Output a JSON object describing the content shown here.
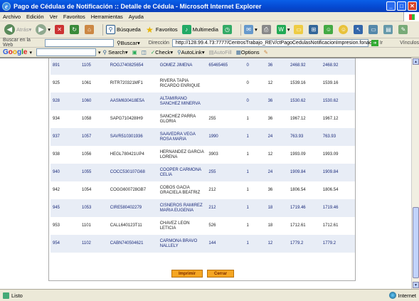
{
  "window": {
    "title": "Pago de Cédulas de Notificación :: Detalle de Cédula - Microsoft Internet Explorer"
  },
  "menu": [
    "Archivo",
    "Edición",
    "Ver",
    "Favoritos",
    "Herramientas",
    "Ayuda"
  ],
  "toolbar": {
    "back": "Atrás",
    "search": "Búsqueda",
    "favorites": "Favoritos",
    "multimedia": "Multimedia"
  },
  "addressbar": {
    "search_label": "Buscar en la Web",
    "search_button": "Buscar",
    "address_label": "Dirección",
    "url": "http://128.99.4.73:7777/CentrosTrabajo_REV/ctPagoCedulasNotificacionImpresion.fonacot",
    "go": "Ir",
    "links": "Vínculos"
  },
  "googlebar": {
    "logo": "Google",
    "search": "Search",
    "check": "Check",
    "autolink": "AutoLink",
    "autofill": "AutoFill",
    "options": "Options"
  },
  "table": {
    "rows": [
      [
        "891",
        "1105",
        "ROGJ740825654",
        "GOMEZ JIMENA",
        "65465465",
        "0",
        "36",
        "2468.92",
        "2468.92"
      ],
      [
        "925",
        "1061",
        "RITR720321MF1",
        "RIVERA TAPIA RICARDO ENRIQUE",
        "",
        "0",
        "12",
        "1539.16",
        "1539.16"
      ],
      [
        "928",
        "1060",
        "AASM630418E5A",
        "ALTAMIRANO SANCHEZ MINERVA",
        "",
        "0",
        "36",
        "1530.62",
        "1530.62"
      ],
      [
        "934",
        "1058",
        "SAPG710428IH9",
        "SANCHEZ PARRA GLORIA",
        "255",
        "1",
        "36",
        "1967.12",
        "1967.12"
      ],
      [
        "937",
        "1057",
        "SAVR510301936",
        "SAAVEDRA VEGA ROSA MARIA",
        "1990",
        "1",
        "24",
        "763.93",
        "763.93"
      ],
      [
        "938",
        "1056",
        "HEGL780421UP4",
        "HERNANDEZ GARCIA LORENA",
        "3903",
        "1",
        "12",
        "1993.09",
        "1993.09"
      ],
      [
        "940",
        "1055",
        "COCC530107G68",
        "COOPER CARMONA CELIA",
        "255",
        "1",
        "24",
        "1909.84",
        "1909.84"
      ],
      [
        "942",
        "1054",
        "COGG600728GB7",
        "COBOS GACIA GRACIELA BEATRIZ",
        "212",
        "1",
        "36",
        "1806.54",
        "1806.54"
      ],
      [
        "945",
        "1053",
        "CIRE580402279",
        "CISNEROS RAMIREZ MARIA EUGENIA",
        "212",
        "1",
        "18",
        "1719.46",
        "1719.46"
      ],
      [
        "953",
        "1101",
        "CALL640123T11",
        "CHAVEZ LEON LETICIA",
        "526",
        "1",
        "18",
        "1712.61",
        "1712.61"
      ],
      [
        "954",
        "1102",
        "CABN740504621",
        "CARMONA BRAVO NALLELY",
        "144",
        "1",
        "12",
        "1779.2",
        "1779.2"
      ]
    ]
  },
  "buttons": {
    "print": "Imprimir",
    "close": "Cerrar"
  },
  "status": {
    "text": "Listo",
    "zone": "Internet"
  }
}
